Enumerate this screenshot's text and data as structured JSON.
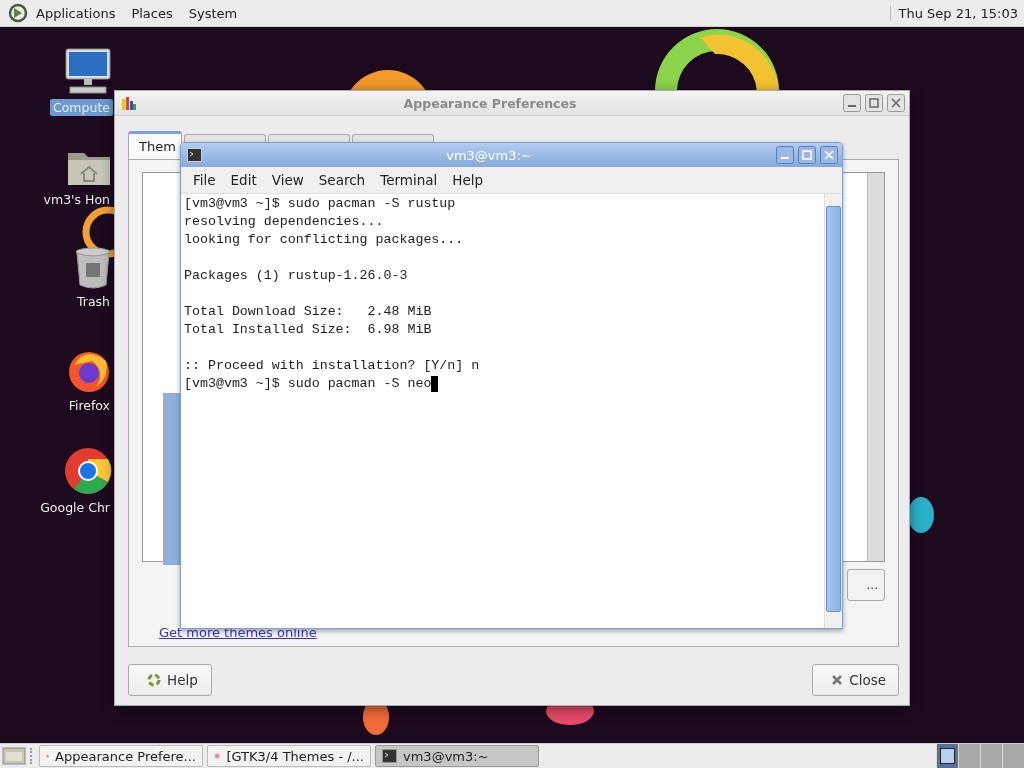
{
  "top_panel": {
    "menus": [
      "Applications",
      "Places",
      "System"
    ],
    "clock": "Thu Sep 21, 15:03"
  },
  "desktop_icons": [
    {
      "label": "Compute",
      "kind": "computer",
      "selected": true
    },
    {
      "label": "vm3's Hon",
      "kind": "home",
      "selected": false
    },
    {
      "label": "Trash",
      "kind": "trash",
      "selected": false
    },
    {
      "label": "Firefox",
      "kind": "firefox",
      "selected": false
    },
    {
      "label": "Google Chr",
      "kind": "chrome",
      "selected": false
    }
  ],
  "appearance_window": {
    "title": "Appearance Preferences",
    "tabs": [
      {
        "label": "Them",
        "selected": true
      }
    ],
    "side_button": "...",
    "link": "Get more themes online",
    "buttons": [
      {
        "label": "Help",
        "kind": "help"
      },
      {
        "label": "Close",
        "kind": "close"
      }
    ]
  },
  "terminal": {
    "title": "vm3@vm3:~",
    "menu": [
      "File",
      "Edit",
      "View",
      "Search",
      "Terminal",
      "Help"
    ],
    "blocks": [
      [
        "[vm3@vm3 ~]$ sudo pacman -S rustup",
        "resolving dependencies...",
        "looking for conflicting packages..."
      ],
      [
        "Packages (1) rustup-1.26.0-3"
      ],
      [
        "Total Download Size:   2.48 MiB",
        "Total Installed Size:  6.98 MiB"
      ],
      [
        ":: Proceed with installation? [Y/n] n",
        "[vm3@vm3 ~]$ sudo pacman -S neo"
      ]
    ],
    "cursor": true
  },
  "taskbar": {
    "tasks": [
      {
        "label": "Appearance Prefere...",
        "kind": "appearance",
        "selected": false
      },
      {
        "label": "[GTK3/4 Themes - /...",
        "kind": "browser",
        "selected": false
      },
      {
        "label": "vm3@vm3:~",
        "kind": "terminal",
        "selected": true
      }
    ],
    "workspaces": [
      {
        "selected": true
      },
      {
        "selected": false
      },
      {
        "selected": false
      },
      {
        "selected": false
      }
    ]
  }
}
